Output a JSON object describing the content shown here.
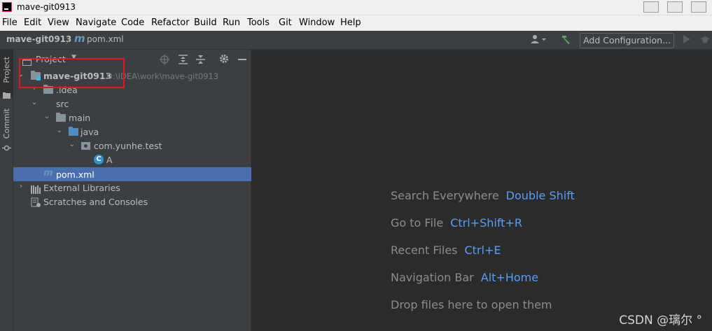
{
  "window": {
    "title": "mave-git0913"
  },
  "menu": [
    "File",
    "Edit",
    "View",
    "Navigate",
    "Code",
    "Refactor",
    "Build",
    "Run",
    "Tools",
    "Git",
    "Window",
    "Help"
  ],
  "navbar": {
    "project": "mave-git0913",
    "file": "pom.xml",
    "maven_glyph": "m",
    "add_configuration": "Add Configuration..."
  },
  "stripe": {
    "project_tab": "Project",
    "commit_tab": "Commit"
  },
  "panel": {
    "title": "Project"
  },
  "tree": [
    {
      "label": "mave-git0913",
      "path": "D:\\IDEA\\work\\mave-git0913",
      "icon": "module-folder-icon",
      "expanded": true
    },
    {
      "label": ".idea",
      "icon": "folder-icon",
      "expanded": false
    },
    {
      "label": "src",
      "icon": "none",
      "expanded": true
    },
    {
      "label": "main",
      "icon": "folder-icon",
      "expanded": true
    },
    {
      "label": "java",
      "icon": "source-folder-icon",
      "expanded": true
    },
    {
      "label": "com.yunhe.test",
      "icon": "package-icon",
      "expanded": true
    },
    {
      "label": "A",
      "icon": "class-icon"
    },
    {
      "label": "pom.xml",
      "icon": "maven-icon",
      "selected": true
    },
    {
      "label": "External Libraries",
      "icon": "libraries-icon",
      "expanded": false
    },
    {
      "label": "Scratches and Consoles",
      "icon": "scratches-icon"
    }
  ],
  "editor": {
    "hints": [
      {
        "text": "Search Everywhere",
        "key": "Double Shift"
      },
      {
        "text": "Go to File",
        "key": "Ctrl+Shift+R"
      },
      {
        "text": "Recent Files",
        "key": "Ctrl+E"
      },
      {
        "text": "Navigation Bar",
        "key": "Alt+Home"
      },
      {
        "text": "Drop files here to open them",
        "key": ""
      }
    ]
  },
  "watermark": "CSDN @璃尔 °",
  "colors": {
    "selection": "#4b6eaf",
    "shortcut": "#589df6",
    "highlight_box": "#e3161f"
  }
}
